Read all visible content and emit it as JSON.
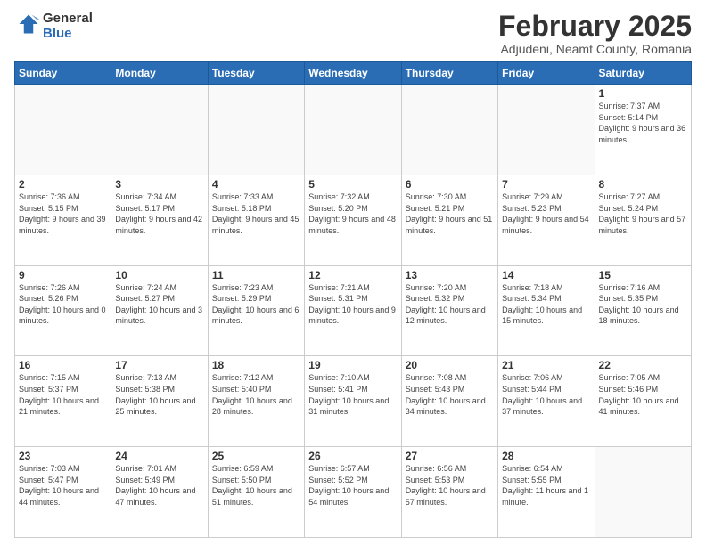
{
  "header": {
    "logo_general": "General",
    "logo_blue": "Blue",
    "month_title": "February 2025",
    "location": "Adjudeni, Neamt County, Romania"
  },
  "weekdays": [
    "Sunday",
    "Monday",
    "Tuesday",
    "Wednesday",
    "Thursday",
    "Friday",
    "Saturday"
  ],
  "weeks": [
    [
      {
        "day": "",
        "info": ""
      },
      {
        "day": "",
        "info": ""
      },
      {
        "day": "",
        "info": ""
      },
      {
        "day": "",
        "info": ""
      },
      {
        "day": "",
        "info": ""
      },
      {
        "day": "",
        "info": ""
      },
      {
        "day": "1",
        "info": "Sunrise: 7:37 AM\nSunset: 5:14 PM\nDaylight: 9 hours and 36 minutes."
      }
    ],
    [
      {
        "day": "2",
        "info": "Sunrise: 7:36 AM\nSunset: 5:15 PM\nDaylight: 9 hours and 39 minutes."
      },
      {
        "day": "3",
        "info": "Sunrise: 7:34 AM\nSunset: 5:17 PM\nDaylight: 9 hours and 42 minutes."
      },
      {
        "day": "4",
        "info": "Sunrise: 7:33 AM\nSunset: 5:18 PM\nDaylight: 9 hours and 45 minutes."
      },
      {
        "day": "5",
        "info": "Sunrise: 7:32 AM\nSunset: 5:20 PM\nDaylight: 9 hours and 48 minutes."
      },
      {
        "day": "6",
        "info": "Sunrise: 7:30 AM\nSunset: 5:21 PM\nDaylight: 9 hours and 51 minutes."
      },
      {
        "day": "7",
        "info": "Sunrise: 7:29 AM\nSunset: 5:23 PM\nDaylight: 9 hours and 54 minutes."
      },
      {
        "day": "8",
        "info": "Sunrise: 7:27 AM\nSunset: 5:24 PM\nDaylight: 9 hours and 57 minutes."
      }
    ],
    [
      {
        "day": "9",
        "info": "Sunrise: 7:26 AM\nSunset: 5:26 PM\nDaylight: 10 hours and 0 minutes."
      },
      {
        "day": "10",
        "info": "Sunrise: 7:24 AM\nSunset: 5:27 PM\nDaylight: 10 hours and 3 minutes."
      },
      {
        "day": "11",
        "info": "Sunrise: 7:23 AM\nSunset: 5:29 PM\nDaylight: 10 hours and 6 minutes."
      },
      {
        "day": "12",
        "info": "Sunrise: 7:21 AM\nSunset: 5:31 PM\nDaylight: 10 hours and 9 minutes."
      },
      {
        "day": "13",
        "info": "Sunrise: 7:20 AM\nSunset: 5:32 PM\nDaylight: 10 hours and 12 minutes."
      },
      {
        "day": "14",
        "info": "Sunrise: 7:18 AM\nSunset: 5:34 PM\nDaylight: 10 hours and 15 minutes."
      },
      {
        "day": "15",
        "info": "Sunrise: 7:16 AM\nSunset: 5:35 PM\nDaylight: 10 hours and 18 minutes."
      }
    ],
    [
      {
        "day": "16",
        "info": "Sunrise: 7:15 AM\nSunset: 5:37 PM\nDaylight: 10 hours and 21 minutes."
      },
      {
        "day": "17",
        "info": "Sunrise: 7:13 AM\nSunset: 5:38 PM\nDaylight: 10 hours and 25 minutes."
      },
      {
        "day": "18",
        "info": "Sunrise: 7:12 AM\nSunset: 5:40 PM\nDaylight: 10 hours and 28 minutes."
      },
      {
        "day": "19",
        "info": "Sunrise: 7:10 AM\nSunset: 5:41 PM\nDaylight: 10 hours and 31 minutes."
      },
      {
        "day": "20",
        "info": "Sunrise: 7:08 AM\nSunset: 5:43 PM\nDaylight: 10 hours and 34 minutes."
      },
      {
        "day": "21",
        "info": "Sunrise: 7:06 AM\nSunset: 5:44 PM\nDaylight: 10 hours and 37 minutes."
      },
      {
        "day": "22",
        "info": "Sunrise: 7:05 AM\nSunset: 5:46 PM\nDaylight: 10 hours and 41 minutes."
      }
    ],
    [
      {
        "day": "23",
        "info": "Sunrise: 7:03 AM\nSunset: 5:47 PM\nDaylight: 10 hours and 44 minutes."
      },
      {
        "day": "24",
        "info": "Sunrise: 7:01 AM\nSunset: 5:49 PM\nDaylight: 10 hours and 47 minutes."
      },
      {
        "day": "25",
        "info": "Sunrise: 6:59 AM\nSunset: 5:50 PM\nDaylight: 10 hours and 51 minutes."
      },
      {
        "day": "26",
        "info": "Sunrise: 6:57 AM\nSunset: 5:52 PM\nDaylight: 10 hours and 54 minutes."
      },
      {
        "day": "27",
        "info": "Sunrise: 6:56 AM\nSunset: 5:53 PM\nDaylight: 10 hours and 57 minutes."
      },
      {
        "day": "28",
        "info": "Sunrise: 6:54 AM\nSunset: 5:55 PM\nDaylight: 11 hours and 1 minute."
      },
      {
        "day": "",
        "info": ""
      }
    ]
  ]
}
